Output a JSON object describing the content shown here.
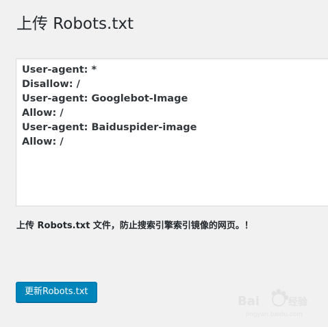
{
  "page": {
    "title": "上传 Robots.txt"
  },
  "editor": {
    "lines": [
      "User-agent: *",
      "Disallow: /",
      "User-agent: Googlebot-Image",
      "Allow: /",
      "User-agent: Baiduspider-image",
      "Allow: /"
    ]
  },
  "note": {
    "text": "上传 Robots.txt 文件，防止搜索引擎索引镜像的网页。！"
  },
  "actions": {
    "update_label": "更新Robots.txt"
  },
  "watermark": {
    "brand": "Baidu",
    "sub": "jingyan.baidu.com",
    "color": "#e0e0e0"
  }
}
